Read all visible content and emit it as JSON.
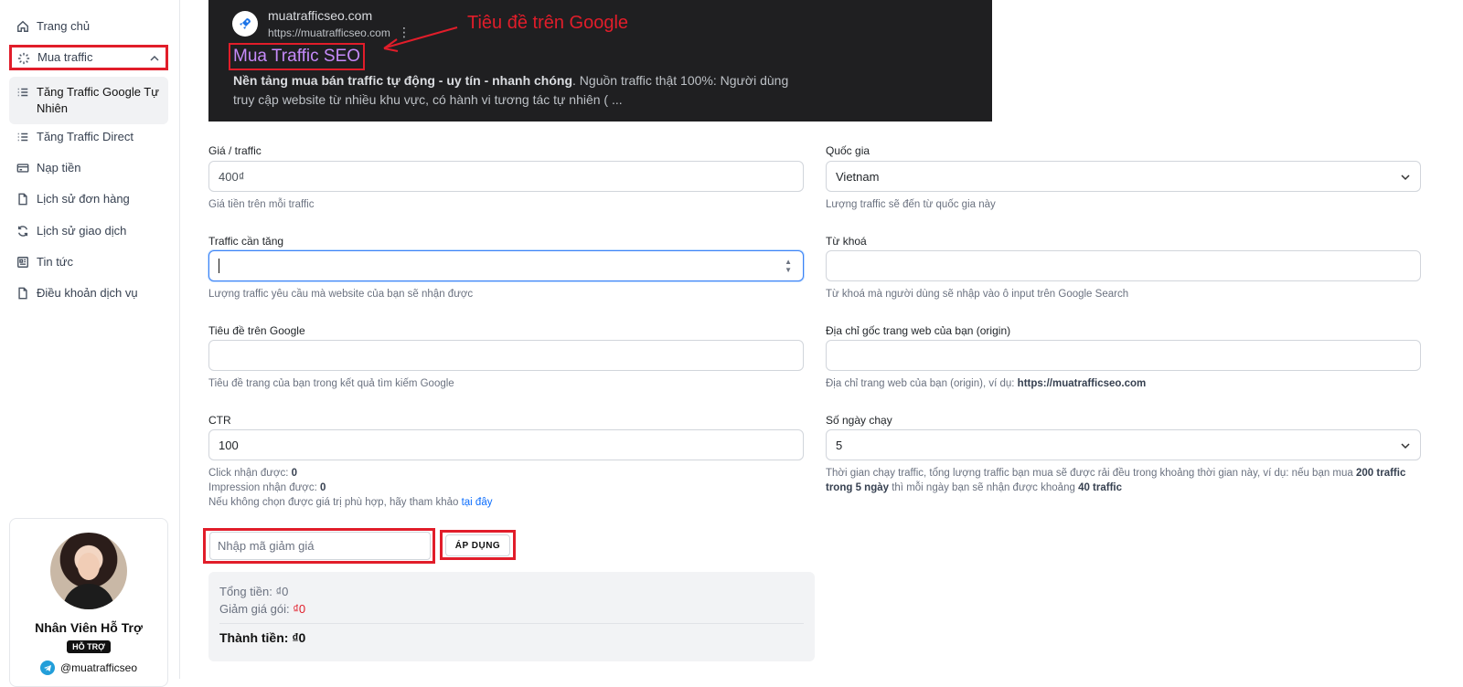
{
  "sidebar": {
    "items": [
      {
        "label": "Trang chủ",
        "icon": "home-icon"
      },
      {
        "label": "Mua traffic",
        "icon": "sparkle-icon"
      },
      {
        "label": "Tăng Traffic Google Tự Nhiên",
        "icon": "list-icon"
      },
      {
        "label": "Tăng Traffic Direct",
        "icon": "list-icon"
      },
      {
        "label": "Nạp tiền",
        "icon": "card-icon"
      },
      {
        "label": "Lịch sử đơn hàng",
        "icon": "file-icon"
      },
      {
        "label": "Lịch sử giao dịch",
        "icon": "refresh-icon"
      },
      {
        "label": "Tin tức",
        "icon": "news-icon"
      },
      {
        "label": "Điều khoản dịch vụ",
        "icon": "file-icon"
      }
    ],
    "support": {
      "name": "Nhân Viên Hỗ Trợ",
      "badge": "HỖ TRỢ",
      "telegram": "@muatrafficseo"
    }
  },
  "preview": {
    "site_name": "muatrafficseo.com",
    "site_url": "https://muatrafficseo.com",
    "title": "Mua Traffic SEO",
    "desc_bold": "Nền tảng mua bán traffic tự động - uy tín - nhanh chóng",
    "desc_rest": ". Nguồn traffic thật 100%: Người dùng truy cập website từ nhiều khu vực, có hành vi tương tác tự nhiên ( ...",
    "annotation": "Tiêu đề trên Google"
  },
  "form": {
    "price": {
      "label": "Giá / traffic",
      "value": "400₫",
      "help": "Giá tiền trên mỗi traffic"
    },
    "country": {
      "label": "Quốc gia",
      "value": "Vietnam",
      "help": "Lượng traffic sẽ đến từ quốc gia này"
    },
    "traffic": {
      "label": "Traffic cần tăng",
      "value": "",
      "help": "Lượng traffic yêu cầu mà website của bạn sẽ nhận được"
    },
    "keyword": {
      "label": "Từ khoá",
      "value": "",
      "help": "Từ khoá mà người dùng sẽ nhập vào ô input trên Google Search"
    },
    "google_title": {
      "label": "Tiêu đề trên Google",
      "value": "",
      "help": "Tiêu đề trang của bạn trong kết quả tìm kiếm Google"
    },
    "origin": {
      "label": "Địa chỉ gốc trang web của bạn (origin)",
      "value": "",
      "help_prefix": "Địa chỉ trang web của bạn (origin), ví dụ: ",
      "help_example": "https://muatrafficseo.com"
    },
    "ctr": {
      "label": "CTR",
      "value": "100",
      "click_label": "Click nhận được: ",
      "click_value": "0",
      "impression_label": "Impression nhận được: ",
      "impression_value": "0",
      "hint": "Nếu không chọn được giá trị phù hợp, hãy tham khảo ",
      "hint_link": "tại đây"
    },
    "days": {
      "label": "Số ngày chạy",
      "value": "5",
      "help_1": "Thời gian chạy traffic, tổng lượng traffic bạn mua sẽ được rải đều trong khoảng thời gian này, ví dụ: nếu bạn mua ",
      "help_b1": "200 traffic trong 5 ngày",
      "help_2": " thì mỗi ngày bạn sẽ nhận được khoảng ",
      "help_b2": "40 traffic"
    },
    "coupon": {
      "placeholder": "Nhập mã giảm giá",
      "apply_label": "ÁP DỤNG"
    }
  },
  "summary": {
    "total_label": "Tổng tiền: ",
    "total_value": "₫0",
    "discount_label": "Giảm giá gói: ",
    "discount_value": "₫0",
    "final_label": "Thành tiền: ",
    "final_value": "₫0"
  },
  "colors": {
    "highlight": "#e11d2a",
    "link": "#0d6efd",
    "preview_title": "#c58af9"
  }
}
